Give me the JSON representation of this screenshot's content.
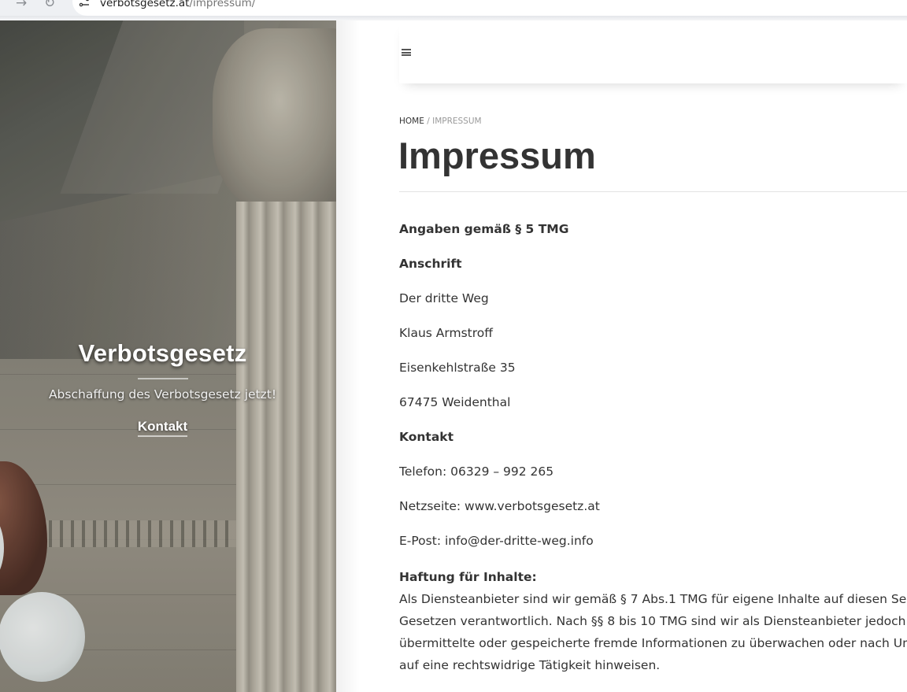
{
  "browser": {
    "url_domain": "verbotsgesetz.at",
    "url_path": "/impressum/",
    "forward_icon": "arrow-right-icon",
    "reload_icon": "reload-icon",
    "site_info_icon": "tune-icon"
  },
  "hero": {
    "title": "Verbotsgesetz",
    "tagline": "Abschaffung des Verbotsgesetz jetzt!",
    "contact_link": "Kontakt"
  },
  "header": {
    "menu_icon": "hamburger-menu-icon"
  },
  "breadcrumb": {
    "home": "HOME",
    "separator": "/",
    "current": "IMPRESSUM"
  },
  "page": {
    "title": "Impressum"
  },
  "content": {
    "heading_tmg": "Angaben gemäß § 5 TMG",
    "heading_address": "Anschrift",
    "org": "Der dritte Weg",
    "name": "Klaus Armstroff",
    "street": "Eisenkehlstraße 35",
    "city": "67475 Weidenthal",
    "heading_contact": "Kontakt",
    "phone": "Telefon: 06329 – 992 265",
    "website": "Netzseite: www.verbotsgesetz.at",
    "email": "E-Post: info@der-dritte-weg.info",
    "heading_liability": "Haftung für Inhalte:",
    "liability_lines": [
      "Als Diensteanbieter sind wir gemäß § 7 Abs.1 TMG für eigene Inhalte auf diesen Seiten",
      "Gesetzen verantwortlich. Nach §§ 8 bis 10 TMG sind wir als Diensteanbieter jedoch nicht",
      "übermittelte oder gespeicherte fremde Informationen zu überwachen oder nach Ums",
      "auf eine rechtswidrige Tätigkeit hinweisen."
    ]
  }
}
